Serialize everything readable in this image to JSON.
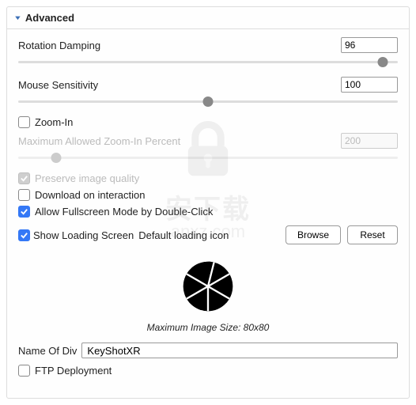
{
  "section_title": "Advanced",
  "rotation": {
    "label": "Rotation Damping",
    "value": "96",
    "slider_percent": 96
  },
  "mouse": {
    "label": "Mouse Sensitivity",
    "value": "100",
    "slider_percent": 50
  },
  "zoom_in": {
    "label": "Zoom-In",
    "checked": false
  },
  "max_zoom": {
    "label": "Maximum Allowed Zoom-In Percent",
    "value": "200",
    "slider_percent": 10
  },
  "preserve": {
    "label": "Preserve image quality",
    "checked": true
  },
  "download": {
    "label": "Download on interaction",
    "checked": false
  },
  "fullscreen": {
    "label": "Allow Fullscreen Mode by Double-Click",
    "checked": true
  },
  "loading": {
    "show_label": "Show Loading Screen",
    "checked": true,
    "default_label": "Default loading icon"
  },
  "browse_btn": "Browse",
  "reset_btn": "Reset",
  "caption": "Maximum Image Size: 80x80",
  "name_div": {
    "label": "Name Of Div",
    "value": "KeyShotXR"
  },
  "ftp": {
    "label": "FTP Deployment",
    "checked": false
  },
  "watermark": {
    "line1": "安下载",
    "line2": "anxz.com"
  }
}
